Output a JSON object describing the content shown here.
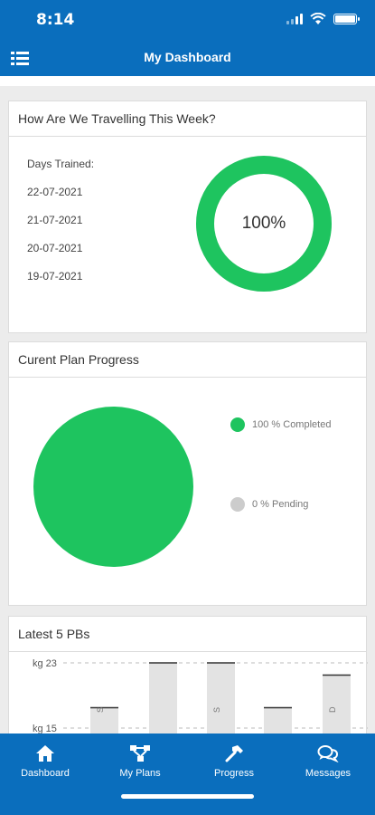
{
  "status": {
    "time": "8:14"
  },
  "header": {
    "title": "My Dashboard"
  },
  "weekly_card": {
    "title": "How Are We Travelling This Week?",
    "days_label": "Days Trained:",
    "days": [
      "22-07-2021",
      "21-07-2021",
      "20-07-2021",
      "19-07-2021"
    ],
    "progress_label": "100%",
    "progress_value": 1.0,
    "ring_color": "#1ec45f"
  },
  "plan_card": {
    "title": "Curent Plan Progress",
    "completed_label": "100 % Completed",
    "pending_label": "0 % Pending",
    "completed_color": "#1ec45f",
    "pending_color": "#cccccc"
  },
  "pb_card": {
    "title": "Latest 5 PBs"
  },
  "chart_data": {
    "type": "bar",
    "ytick_labels": [
      "kg 23",
      "kg 15"
    ],
    "yticks": [
      23,
      15
    ],
    "values": [
      17.5,
      23,
      23,
      17.5,
      21.5
    ],
    "bar_label_fragments": [
      "S",
      "",
      "S",
      "",
      "D"
    ],
    "ylim": [
      12,
      24
    ]
  },
  "tabs": [
    {
      "label": "Dashboard",
      "icon": "home-icon"
    },
    {
      "label": "My Plans",
      "icon": "plans-network-icon"
    },
    {
      "label": "Progress",
      "icon": "hammer-icon"
    },
    {
      "label": "Messages",
      "icon": "chat-bubbles-icon"
    }
  ],
  "colors": {
    "primary": "#0a6ebd",
    "accent_green": "#1ec45f"
  }
}
